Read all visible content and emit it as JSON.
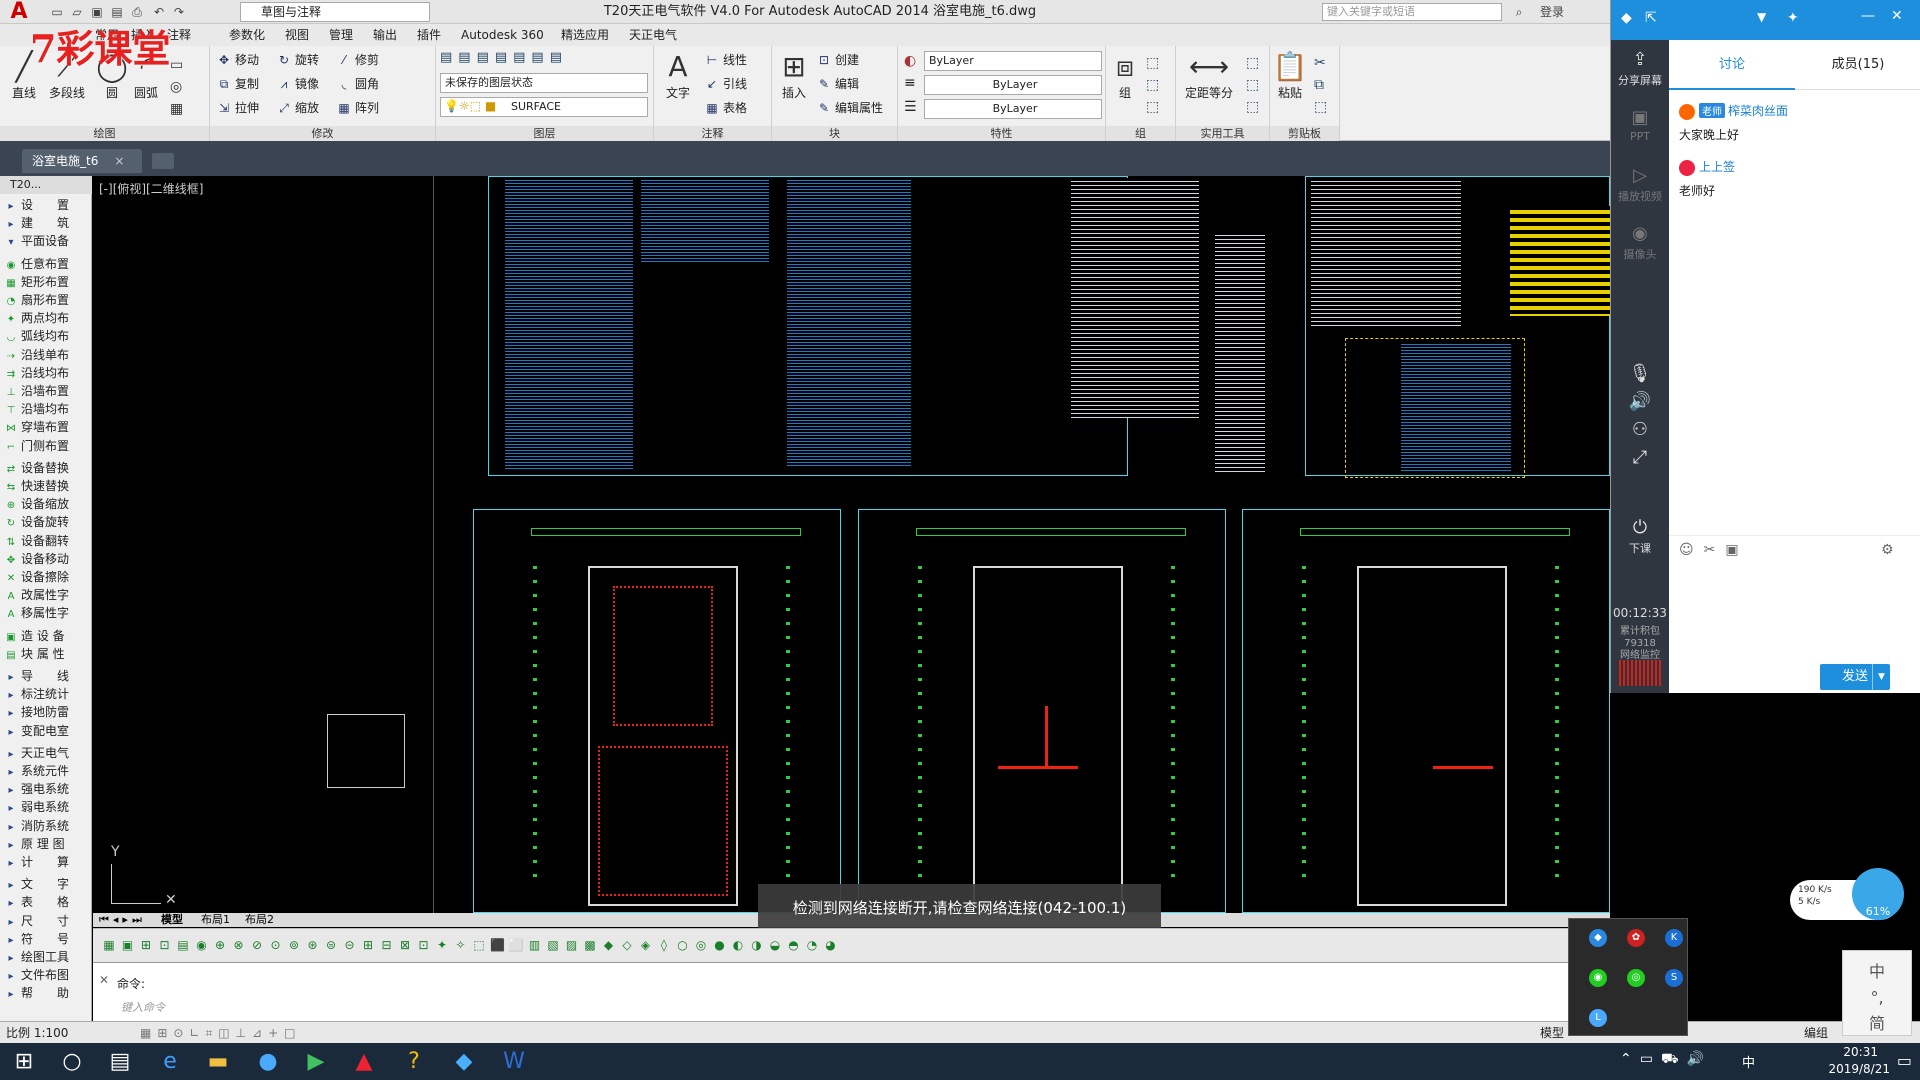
{
  "window": {
    "title": "T20天正电气软件 V4.0 For Autodesk AutoCAD 2014    浴室电施_t6.dwg",
    "workspace": "草图与注释",
    "search_placeholder": "键入关键字或短语",
    "login": "登录"
  },
  "menu": [
    "常用",
    "插入",
    "注释",
    "参数化",
    "视图",
    "管理",
    "输出",
    "插件",
    "Autodesk 360",
    "精选应用",
    "天正电气"
  ],
  "ribbon": {
    "draw": {
      "title": "绘图",
      "tools": [
        "直线",
        "多段线",
        "圆",
        "圆弧"
      ]
    },
    "modify": {
      "title": "修改",
      "tools": [
        "移动",
        "旋转",
        "修剪",
        "复制",
        "镜像",
        "圆角",
        "拉伸",
        "缩放",
        "阵列"
      ]
    },
    "layer": {
      "title": "图层",
      "state": "未保存的图层状态",
      "current": "SURFACE"
    },
    "annotation": {
      "title": "注释",
      "tools": [
        "文字",
        "线性",
        "引线",
        "表格"
      ]
    },
    "block": {
      "title": "块",
      "tools": [
        "插入",
        "创建",
        "编辑",
        "编辑属性"
      ]
    },
    "properties": {
      "title": "特性",
      "color": "ByLayer",
      "linetype": "ByLayer",
      "lineweight": "ByLayer"
    },
    "group": {
      "title": "组",
      "tools": [
        "组"
      ]
    },
    "utilities": {
      "title": "实用工具",
      "tools": [
        "定距等分"
      ]
    },
    "clipboard": {
      "title": "剪贴板",
      "tools": [
        "粘贴"
      ]
    }
  },
  "doc_tab": "浴室电施_t6",
  "palette": {
    "title": "T20...",
    "items": [
      "设　　置",
      "建　　筑",
      "平面设备",
      "任意布置",
      "矩形布置",
      "扇形布置",
      "两点均布",
      "弧线均布",
      "沿线单布",
      "沿线均布",
      "沿墙布置",
      "沿墙均布",
      "穿墙布置",
      "门侧布置",
      "设备替换",
      "快速替换",
      "设备缩放",
      "设备旋转",
      "设备翻转",
      "设备移动",
      "设备擦除",
      "改属性字",
      "移属性字",
      "造 设 备",
      "块 属 性",
      "导　　线",
      "标注统计",
      "接地防雷",
      "变配电室",
      "天正电气",
      "系统元件",
      "强电系统",
      "弱电系统",
      "消防系统",
      "原 理 图",
      "计　　算",
      "文　　字",
      "表　　格",
      "尺　　寸",
      "符　　号",
      "绘图工具",
      "文件布图",
      "帮　　助"
    ]
  },
  "viewport_label": "[-][俯视][二维线框]",
  "layout_tabs": [
    "模型",
    "布局1",
    "布局2"
  ],
  "network_message": "检测到网络连接断开,请检查网络连接(042-100.1)",
  "command": {
    "label": "命令:",
    "placeholder": "键入命令"
  },
  "status": {
    "scale": "比例 1:100",
    "model": "模型",
    "edit": "编组"
  },
  "watermark": "7彩课堂",
  "chat": {
    "tabs": [
      "讨论",
      "成员(15)"
    ],
    "side": [
      "分享屏幕",
      "PPT",
      "播放视频",
      "摄像头",
      "下课"
    ],
    "timer": "00:12:33",
    "stats": [
      "累计积包",
      "79318",
      "网络监控"
    ],
    "messages": [
      {
        "role": "老师",
        "name": "榨菜肉丝面",
        "text": "大家晚上好"
      },
      {
        "role": "",
        "name": "上上签",
        "text": "老师好"
      }
    ],
    "send": "发送"
  },
  "net_speed": {
    "up": "190 K/s",
    "down": "5 K/s",
    "percent": "61%"
  },
  "clock": {
    "time": "20:31",
    "date": "2019/8/21"
  },
  "ime": [
    "中",
    "简"
  ]
}
